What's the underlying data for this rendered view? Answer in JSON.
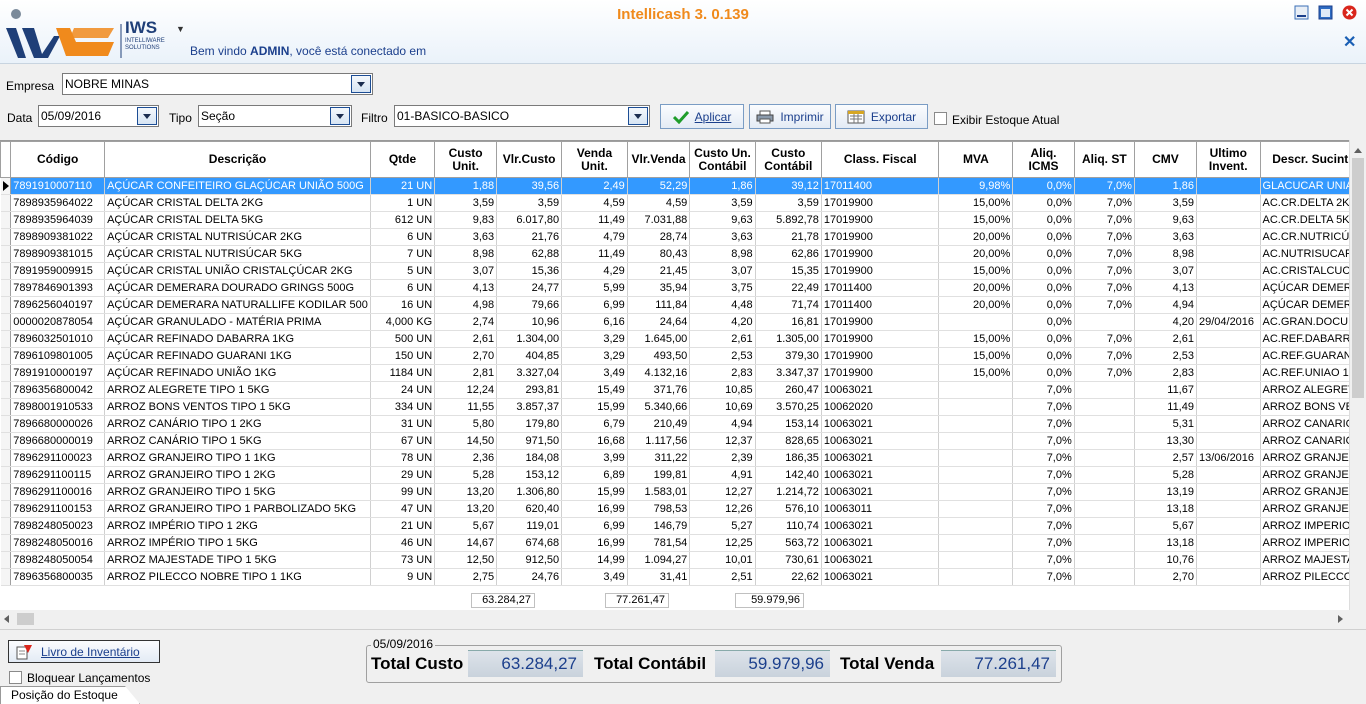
{
  "app": {
    "title": "Intellicash 3. 0.139",
    "logo_text": "IWS",
    "logo_sub": "INTELLIWARE SOLUTIONS",
    "welcome_prefix": "Bem vindo ",
    "user": "ADMIN",
    "welcome_suffix": ", você está conectado em",
    "menu_arrow": "▼"
  },
  "filters": {
    "empresa_label": "Empresa",
    "empresa_value": "NOBRE MINAS",
    "data_label": "Data",
    "data_value": "05/09/2016",
    "tipo_label": "Tipo",
    "tipo_value": "Seção",
    "filtro_label": "Filtro",
    "filtro_value": "01-BASICO-BASICO",
    "aplicar_label": "Aplicar",
    "imprimir_label": "Imprimir",
    "exportar_label": "Exportar",
    "exibir_estoque_label": "Exibir Estoque Atual",
    "exibir_estoque_checked": false
  },
  "grid": {
    "columns": [
      "Código",
      "Descrição",
      "Qtde",
      "Custo Unit.",
      "Vlr.Custo",
      "Venda Unit.",
      "Vlr.Venda",
      "Custo Un. Contábil",
      "Custo Contábil",
      "Class. Fiscal",
      "MVA",
      "Aliq. ICMS",
      "Aliq. ST",
      "CMV",
      "Ultimo Invent.",
      "Descr. Sucint"
    ],
    "rows": [
      [
        "7891910007110",
        "AÇÚCAR CONFEITEIRO GLAÇÚCAR UNIÃO 500G",
        "21 UN",
        "1,88",
        "39,56",
        "2,49",
        "52,29",
        "1,86",
        "39,12",
        "17011400",
        "9,98%",
        "0,0%",
        "7,0%",
        "1,86",
        "",
        "GLACUCAR UNIA"
      ],
      [
        "7898935964022",
        "AÇÚCAR CRISTAL DELTA 2KG",
        "1 UN",
        "3,59",
        "3,59",
        "4,59",
        "4,59",
        "3,59",
        "3,59",
        "17019900",
        "15,00%",
        "0,0%",
        "7,0%",
        "3,59",
        "",
        "AC.CR.DELTA 2K"
      ],
      [
        "7898935964039",
        "AÇÚCAR CRISTAL DELTA 5KG",
        "612 UN",
        "9,83",
        "6.017,80",
        "11,49",
        "7.031,88",
        "9,63",
        "5.892,78",
        "17019900",
        "15,00%",
        "0,0%",
        "7,0%",
        "9,63",
        "",
        "AC.CR.DELTA 5K"
      ],
      [
        "7898909381022",
        "AÇÚCAR CRISTAL NUTRISÚCAR 2KG",
        "6 UN",
        "3,63",
        "21,76",
        "4,79",
        "28,74",
        "3,63",
        "21,78",
        "17019900",
        "20,00%",
        "0,0%",
        "7,0%",
        "3,63",
        "",
        "AC.CR.NUTRICÚ"
      ],
      [
        "7898909381015",
        "AÇÚCAR CRISTAL NUTRISÚCAR 5KG",
        "7 UN",
        "8,98",
        "62,88",
        "11,49",
        "80,43",
        "8,98",
        "62,86",
        "17019900",
        "20,00%",
        "0,0%",
        "7,0%",
        "8,98",
        "",
        "AC.NUTRISUCAR"
      ],
      [
        "7891959009915",
        "AÇÚCAR CRISTAL UNIÃO CRISTALÇÚCAR 2KG",
        "5 UN",
        "3,07",
        "15,36",
        "4,29",
        "21,45",
        "3,07",
        "15,35",
        "17019900",
        "15,00%",
        "0,0%",
        "7,0%",
        "3,07",
        "",
        "AC.CRISTALCUC"
      ],
      [
        "7897846901393",
        "AÇÚCAR DEMERARA DOURADO GRINGS 500G",
        "6 UN",
        "4,13",
        "24,77",
        "5,99",
        "35,94",
        "3,75",
        "22,49",
        "17011400",
        "20,00%",
        "0,0%",
        "7,0%",
        "4,13",
        "",
        "AÇÚCAR DEMER"
      ],
      [
        "7896256040197",
        "AÇÚCAR DEMERARA NATURALLIFE KODILAR 500",
        "16 UN",
        "4,98",
        "79,66",
        "6,99",
        "111,84",
        "4,48",
        "71,74",
        "17011400",
        "20,00%",
        "0,0%",
        "7,0%",
        "4,94",
        "",
        "AÇÚCAR DEMER"
      ],
      [
        "0000020878054",
        "AÇÚCAR GRANULADO - MATÉRIA PRIMA",
        "4,000 KG",
        "2,74",
        "10,96",
        "6,16",
        "24,64",
        "4,20",
        "16,81",
        "17019900",
        "",
        "0,0%",
        "",
        "4,20",
        "29/04/2016",
        "AC.GRAN.DOCU"
      ],
      [
        "7896032501010",
        "AÇÚCAR REFINADO DABARRA 1KG",
        "500 UN",
        "2,61",
        "1.304,00",
        "3,29",
        "1.645,00",
        "2,61",
        "1.305,00",
        "17019900",
        "15,00%",
        "0,0%",
        "7,0%",
        "2,61",
        "",
        "AC.REF.DABARR"
      ],
      [
        "7896109801005",
        "AÇÚCAR REFINADO GUARANI 1KG",
        "150 UN",
        "2,70",
        "404,85",
        "3,29",
        "493,50",
        "2,53",
        "379,30",
        "17019900",
        "15,00%",
        "0,0%",
        "7,0%",
        "2,53",
        "",
        "AC.REF.GUARAN"
      ],
      [
        "7891910000197",
        "AÇÚCAR REFINADO UNIÃO 1KG",
        "1184 UN",
        "2,81",
        "3.327,04",
        "3,49",
        "4.132,16",
        "2,83",
        "3.347,37",
        "17019900",
        "15,00%",
        "0,0%",
        "7,0%",
        "2,83",
        "",
        "AC.REF.UNIAO 1"
      ],
      [
        "7896356800042",
        "ARROZ ALEGRETE TIPO 1 5KG",
        "24 UN",
        "12,24",
        "293,81",
        "15,49",
        "371,76",
        "10,85",
        "260,47",
        "10063021",
        "",
        "7,0%",
        "",
        "11,67",
        "",
        "ARROZ ALEGRETI"
      ],
      [
        "7898001910533",
        "ARROZ BONS VENTOS TIPO 1 5KG",
        "334 UN",
        "11,55",
        "3.857,37",
        "15,99",
        "5.340,66",
        "10,69",
        "3.570,25",
        "10062020",
        "",
        "7,0%",
        "",
        "11,49",
        "",
        "ARROZ BONS VE"
      ],
      [
        "7896680000026",
        "ARROZ CANÁRIO TIPO 1 2KG",
        "31 UN",
        "5,80",
        "179,80",
        "6,79",
        "210,49",
        "4,94",
        "153,14",
        "10063021",
        "",
        "7,0%",
        "",
        "5,31",
        "",
        "ARROZ CANARIO"
      ],
      [
        "7896680000019",
        "ARROZ CANÁRIO TIPO 1 5KG",
        "67 UN",
        "14,50",
        "971,50",
        "16,68",
        "1.117,56",
        "12,37",
        "828,65",
        "10063021",
        "",
        "7,0%",
        "",
        "13,30",
        "",
        "ARROZ CANARIO"
      ],
      [
        "7896291100023",
        "ARROZ GRANJEIRO TIPO 1 1KG",
        "78 UN",
        "2,36",
        "184,08",
        "3,99",
        "311,22",
        "2,39",
        "186,35",
        "10063021",
        "",
        "7,0%",
        "",
        "2,57",
        "13/06/2016",
        "ARROZ GRANJEI"
      ],
      [
        "7896291100115",
        "ARROZ GRANJEIRO TIPO 1 2KG",
        "29 UN",
        "5,28",
        "153,12",
        "6,89",
        "199,81",
        "4,91",
        "142,40",
        "10063021",
        "",
        "7,0%",
        "",
        "5,28",
        "",
        "ARROZ GRANJEI"
      ],
      [
        "7896291100016",
        "ARROZ GRANJEIRO TIPO 1 5KG",
        "99 UN",
        "13,20",
        "1.306,80",
        "15,99",
        "1.583,01",
        "12,27",
        "1.214,72",
        "10063021",
        "",
        "7,0%",
        "",
        "13,19",
        "",
        "ARROZ GRANJEI"
      ],
      [
        "7896291100153",
        "ARROZ GRANJEIRO TIPO 1 PARBOLIZADO 5KG",
        "47 UN",
        "13,20",
        "620,40",
        "16,99",
        "798,53",
        "12,26",
        "576,10",
        "10063011",
        "",
        "7,0%",
        "",
        "13,18",
        "",
        "ARROZ GRANJEI"
      ],
      [
        "7898248050023",
        "ARROZ IMPÉRIO TIPO 1 2KG",
        "21 UN",
        "5,67",
        "119,01",
        "6,99",
        "146,79",
        "5,27",
        "110,74",
        "10063021",
        "",
        "7,0%",
        "",
        "5,67",
        "",
        "ARROZ IMPERIO"
      ],
      [
        "7898248050016",
        "ARROZ IMPÉRIO TIPO 1 5KG",
        "46 UN",
        "14,67",
        "674,68",
        "16,99",
        "781,54",
        "12,25",
        "563,72",
        "10063021",
        "",
        "7,0%",
        "",
        "13,18",
        "",
        "ARROZ IMPERIO"
      ],
      [
        "7898248050054",
        "ARROZ MAJESTADE TIPO 1 5KG",
        "73 UN",
        "12,50",
        "912,50",
        "14,99",
        "1.094,27",
        "10,01",
        "730,61",
        "10063021",
        "",
        "7,0%",
        "",
        "10,76",
        "",
        "ARROZ MAJESTA"
      ],
      [
        "7896356800035",
        "ARROZ PILECCO NOBRE TIPO 1 1KG",
        "9 UN",
        "2,75",
        "24,76",
        "3,49",
        "31,41",
        "2,51",
        "22,62",
        "10063021",
        "",
        "7,0%",
        "",
        "2,70",
        "",
        "ARROZ PILECCO"
      ]
    ],
    "sums": {
      "vlr_custo": "63.284,27",
      "vlr_venda": "77.261,47",
      "custo_contabil": "59.979,96"
    }
  },
  "bottom": {
    "livro_label": "Livro de Inventário",
    "bloquear_label": "Bloquear Lançamentos",
    "bloquear_checked": false,
    "group_date": "05/09/2016",
    "total_custo_label": "Total Custo",
    "total_custo_value": "63.284,27",
    "total_contabil_label": "Total Contábil",
    "total_contabil_value": "59.979,96",
    "total_venda_label": "Total Venda",
    "total_venda_value": "77.261,47",
    "tab_label": "Posição do Estoque"
  },
  "colors": {
    "accent_orange": "#f08a1c",
    "selection_blue": "#3399ff",
    "link_blue": "#1b3f8c"
  }
}
